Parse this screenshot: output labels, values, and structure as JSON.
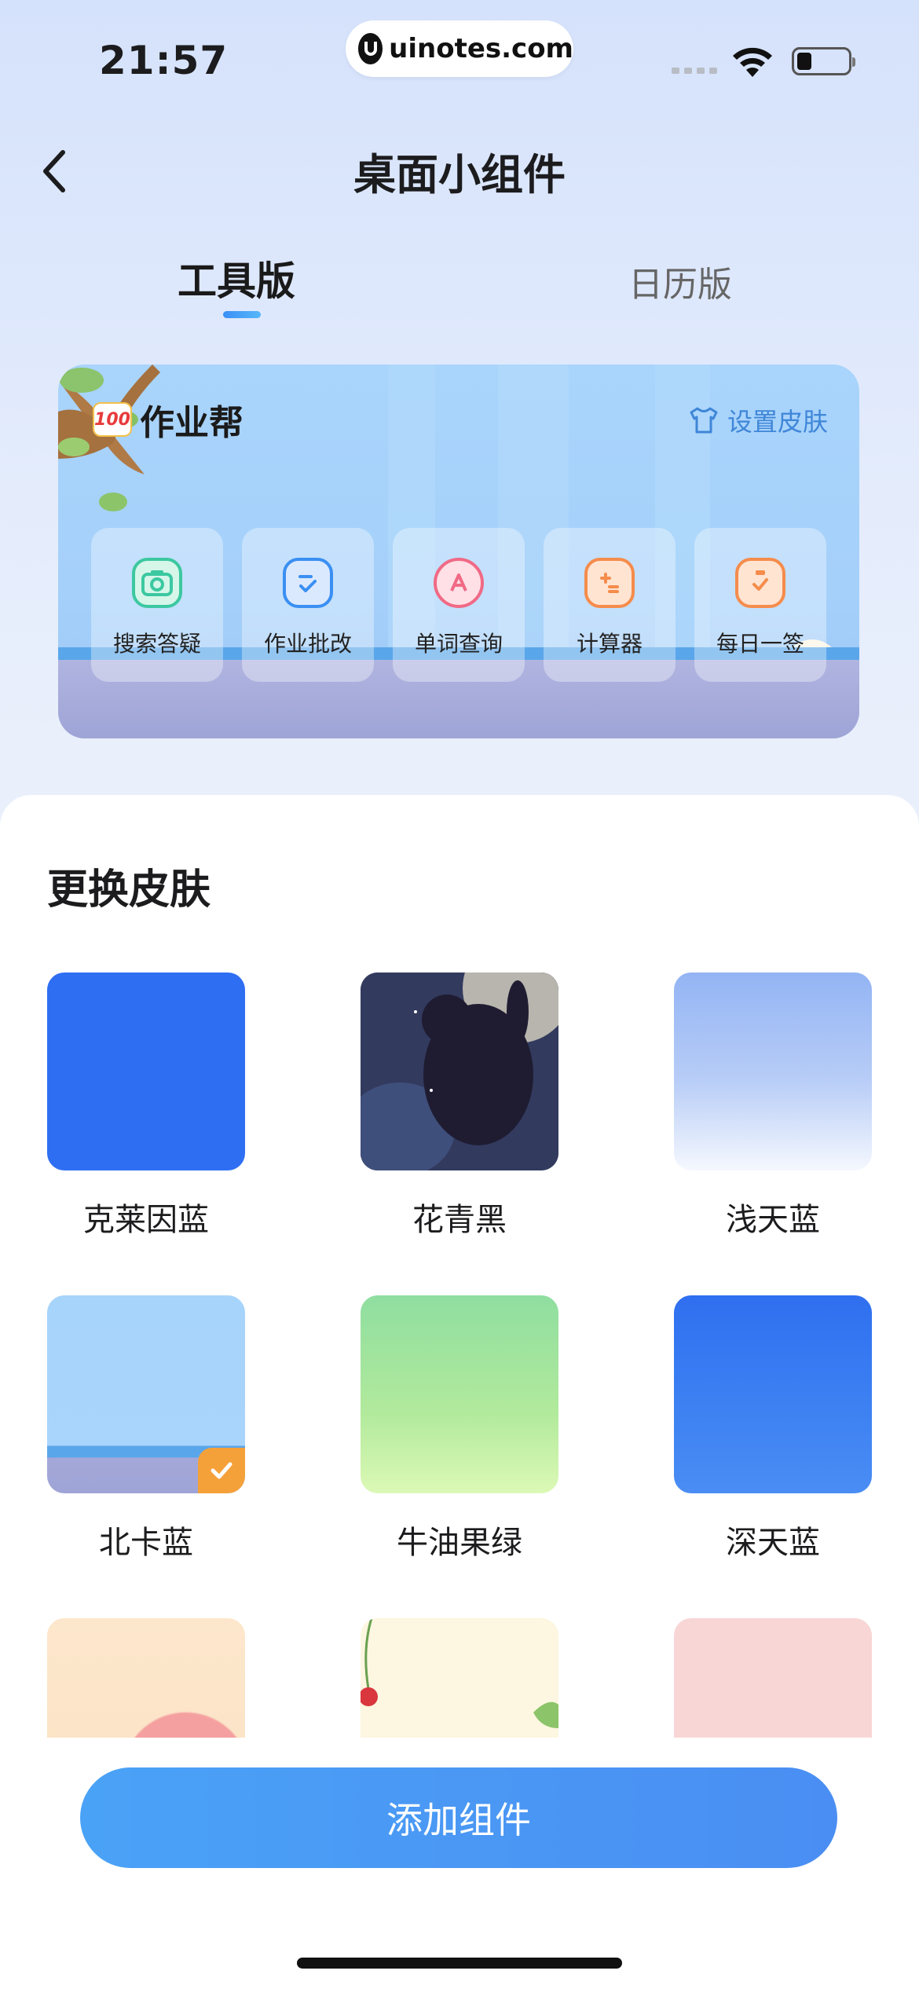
{
  "status_bar": {
    "time": "21:57",
    "url": "uinotes.com"
  },
  "header": {
    "title": "桌面小组件",
    "back_icon": "chevron-left-icon"
  },
  "tabs": [
    {
      "label": "工具版",
      "active": true
    },
    {
      "label": "日历版",
      "active": false
    }
  ],
  "widget": {
    "brand_logo_text": "100",
    "brand_name": "作业帮",
    "skin_link": "设置皮肤",
    "tools": [
      {
        "label": "搜索答疑",
        "icon": "camera-icon",
        "color": "#3cc8a0"
      },
      {
        "label": "作业批改",
        "icon": "check-doc-icon",
        "color": "#3a8ff2"
      },
      {
        "label": "单词查询",
        "icon": "letter-a-search-icon",
        "color": "#f06a86"
      },
      {
        "label": "计算器",
        "icon": "calculator-icon",
        "color": "#f58c4c"
      },
      {
        "label": "每日一签",
        "icon": "clipboard-check-icon",
        "color": "#f58c4c"
      }
    ]
  },
  "skins": {
    "title": "更换皮肤",
    "items": [
      {
        "label": "克莱因蓝",
        "selected": false
      },
      {
        "label": "花青黑",
        "selected": false
      },
      {
        "label": "浅天蓝",
        "selected": false
      },
      {
        "label": "北卡蓝",
        "selected": true
      },
      {
        "label": "牛油果绿",
        "selected": false
      },
      {
        "label": "深天蓝",
        "selected": false
      }
    ]
  },
  "add_button": "添加组件",
  "colors": {
    "accent": "#4a97f5",
    "check_badge": "#f5a13a"
  }
}
